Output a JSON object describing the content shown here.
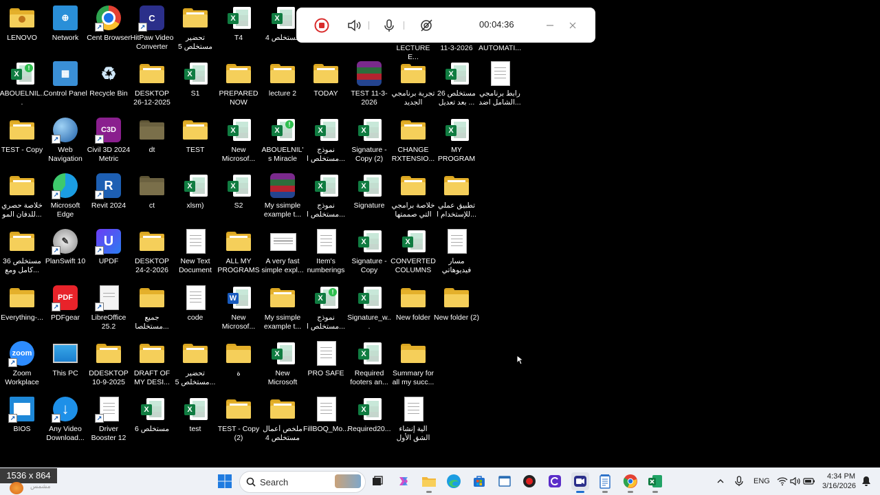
{
  "desktop": {
    "icons": [
      {
        "label": "LENOVO",
        "type": "folder-user"
      },
      {
        "label": "Network",
        "type": "network"
      },
      {
        "label": "Cent Browser",
        "type": "chrome",
        "shortcut": true
      },
      {
        "label": "HitPaw Video Converter",
        "type": "hitpaw",
        "shortcut": true
      },
      {
        "label": "تحضير مستخلص 5",
        "type": "folder"
      },
      {
        "label": "T4",
        "type": "excel"
      },
      {
        "label": "مستخلص 4",
        "type": "excel"
      },
      {
        "label": "ABOUELNIL... GENERATO...",
        "type": "excel-alert"
      },
      {
        "label": "Control Panel",
        "type": "control-panel"
      },
      {
        "label": "Recycle Bin",
        "type": "recycle"
      },
      {
        "label": "DESKTOP 26-12-2025",
        "type": "folder"
      },
      {
        "label": "S1",
        "type": "excel"
      },
      {
        "label": "PREPARED NOW",
        "type": "folder"
      },
      {
        "label": "lecture 2",
        "type": "folder"
      },
      {
        "label": "TODAY",
        "type": "folder"
      },
      {
        "label": "TEST 11-3-2026",
        "type": "winrar"
      },
      {
        "label": "تجربة برنامجي الجديد",
        "type": "folder"
      },
      {
        "label": "مستخلص 26 بعد تعديل ...",
        "type": "excel"
      },
      {
        "label": "رابط برنامجي الشامل اضد...",
        "type": "doc"
      },
      {
        "label": "TEST - Copy",
        "type": "folder"
      },
      {
        "label": "Web Navigation",
        "type": "globe",
        "shortcut": true
      },
      {
        "label": "Civil 3D 2024 Metric",
        "type": "c3d",
        "shortcut": true
      },
      {
        "label": "dt",
        "type": "folder-dark"
      },
      {
        "label": "TEST",
        "type": "folder"
      },
      {
        "label": "New Microsof...",
        "type": "excel"
      },
      {
        "label": "ABOUELNIL's Miracle Aut...",
        "type": "excel-alert"
      },
      {
        "label": "نموذج مستخلص ا...",
        "type": "excel"
      },
      {
        "label": "Signature - Copy (2)",
        "type": "excel"
      },
      {
        "label": "CHANGE RXTENSIO...",
        "type": "folder"
      },
      {
        "label": "MY PROGRAM",
        "type": "excel"
      },
      {
        "label": "خلاصة حصري للدفان المو...",
        "type": "folder"
      },
      {
        "label": "Microsoft Edge",
        "type": "edge",
        "shortcut": true
      },
      {
        "label": "Revit 2024",
        "type": "revit",
        "shortcut": true
      },
      {
        "label": "ct",
        "type": "folder-dark"
      },
      {
        "label": "xlsm)",
        "type": "excel"
      },
      {
        "label": "S2",
        "type": "excel"
      },
      {
        "label": "My ssimple example t...",
        "type": "winrar"
      },
      {
        "label": "نموذج مستخلص ا...",
        "type": "excel"
      },
      {
        "label": "Signature",
        "type": "excel"
      },
      {
        "label": "خلاصة برامجي التي صممتها",
        "type": "folder"
      },
      {
        "label": "تطبيق عملي للإستخدام ا...",
        "type": "folder"
      },
      {
        "label": "مستخلص 36 كامل ومع...",
        "type": "folder"
      },
      {
        "label": "PlanSwift 10",
        "type": "planswift",
        "shortcut": true
      },
      {
        "label": "UPDF",
        "type": "updf",
        "shortcut": true
      },
      {
        "label": "DESKTOP 24-2-2026",
        "type": "folder"
      },
      {
        "label": "New Text Document",
        "type": "doc"
      },
      {
        "label": "ALL MY PROGRAMS",
        "type": "folder"
      },
      {
        "label": "A very fast simple expl...",
        "type": "doc-banner"
      },
      {
        "label": "Item's numberings",
        "type": "doc"
      },
      {
        "label": "Signature - Copy",
        "type": "excel"
      },
      {
        "label": "CONVERTED COLUMNS T...",
        "type": "excel"
      },
      {
        "label": "مسار فيديوهاتي",
        "type": "doc"
      },
      {
        "label": "Everything-...",
        "type": "folder-plain"
      },
      {
        "label": "PDFgear",
        "type": "pdfgear",
        "shortcut": true
      },
      {
        "label": "LibreOffice 25.2",
        "type": "libre",
        "shortcut": true
      },
      {
        "label": "جميع مستخلصا...",
        "type": "folder-plain"
      },
      {
        "label": "code",
        "type": "doc"
      },
      {
        "label": "New Microsof...",
        "type": "word"
      },
      {
        "label": "My ssimple example t...",
        "type": "folder"
      },
      {
        "label": "نموذج مستخلص ا...",
        "type": "excel-alert"
      },
      {
        "label": "Signature_w...",
        "type": "excel"
      },
      {
        "label": "New folder",
        "type": "folder-plain"
      },
      {
        "label": "New folder (2)",
        "type": "folder-plain"
      },
      {
        "label": "Zoom Workplace",
        "type": "zoom",
        "shortcut": true
      },
      {
        "label": "This PC",
        "type": "thispc"
      },
      {
        "label": "DDESKTOP 10-9-2025",
        "type": "folder"
      },
      {
        "label": "DRAFT OF MY DESI...",
        "type": "folder"
      },
      {
        "label": "تحضير مستخلص 5...",
        "type": "folder"
      },
      {
        "label": "ة",
        "type": "folder-plain"
      },
      {
        "label": "New Microsoft Ex...",
        "type": "excel"
      },
      {
        "label": "PRO SAFE",
        "type": "doc"
      },
      {
        "label": "Required footers an...",
        "type": "excel"
      },
      {
        "label": "Summary for all my succ...",
        "type": "folder-plain"
      },
      {
        "label": "BIOS",
        "type": "bios",
        "shortcut": true
      },
      {
        "label": "Any Video Download...",
        "type": "anyvideo",
        "shortcut": true
      },
      {
        "label": "Driver Booster 12",
        "type": "doc",
        "shortcut": true
      },
      {
        "label": "مستخلص 6",
        "type": "excel"
      },
      {
        "label": "test",
        "type": "excel"
      },
      {
        "label": "TEST - Copy (2)",
        "type": "folder"
      },
      {
        "label": "ملخص أعمال مستخلص 4",
        "type": "folder"
      },
      {
        "label": "FillBOQ_Mo...",
        "type": "doc"
      },
      {
        "label": "Required20...",
        "type": "excel"
      },
      {
        "label": "آلية إنشاء الشق الأول (ا...",
        "type": "doc"
      }
    ],
    "hidden_labels": [
      "LECTURE E...",
      "11-3-2026",
      "AUTOMATI..."
    ]
  },
  "recorder": {
    "timer": "00:04:36"
  },
  "overlay": {
    "resolution": "1536 x 864",
    "sub": "مشمس"
  },
  "taskbar": {
    "search_placeholder": "Search",
    "language": "ENG",
    "time": "4:34 PM",
    "date": "3/16/2026"
  }
}
